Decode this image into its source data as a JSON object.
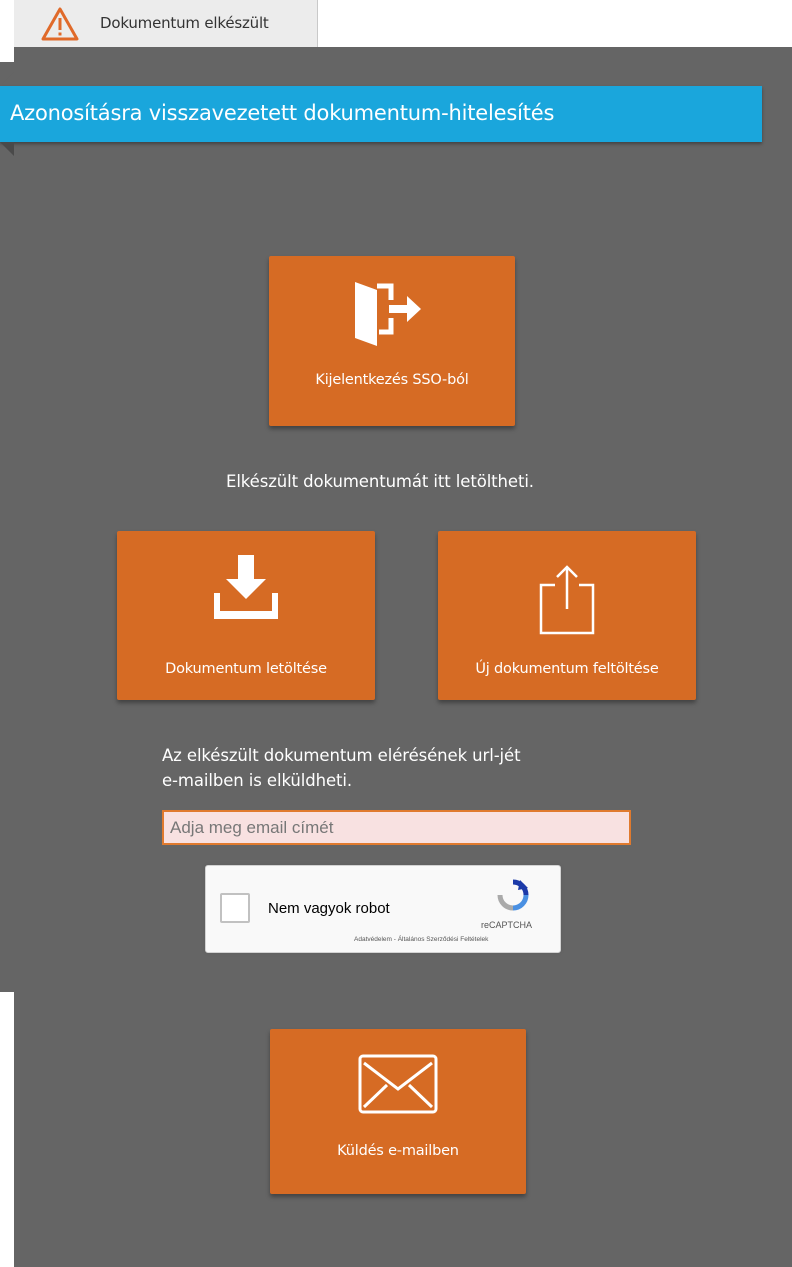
{
  "tab": {
    "label": "Dokumentum elkészült"
  },
  "header": {
    "title": "Azonosításra visszavezetett dokumentum-hitelesítés"
  },
  "logout": {
    "label": "Kijelentkezés SSO-ból",
    "icon": "sign-out-icon"
  },
  "ready_message": "Elkészült dokumentumát itt letöltheti.",
  "download": {
    "label": "Dokumentum letöltése",
    "icon": "download-icon"
  },
  "upload": {
    "label": "Új dokumentum feltöltése",
    "icon": "upload-icon"
  },
  "email_info": {
    "line1": "Az elkészült dokumentum elérésének url-jét",
    "line2": "e-mailben is elküldheti."
  },
  "email_input": {
    "placeholder": "Adja meg email címét",
    "value": ""
  },
  "captcha": {
    "label": "Nem vagyok robot",
    "brand": "reCAPTCHA",
    "terms": "Adatvédelem - Általános Szerződési Feltételek"
  },
  "send": {
    "label": "Küldés e-mailben",
    "icon": "envelope-icon"
  },
  "colors": {
    "accent": "#d66b24",
    "header": "#1aa6dc",
    "panel": "#656565",
    "warning": "#e06a2a"
  }
}
